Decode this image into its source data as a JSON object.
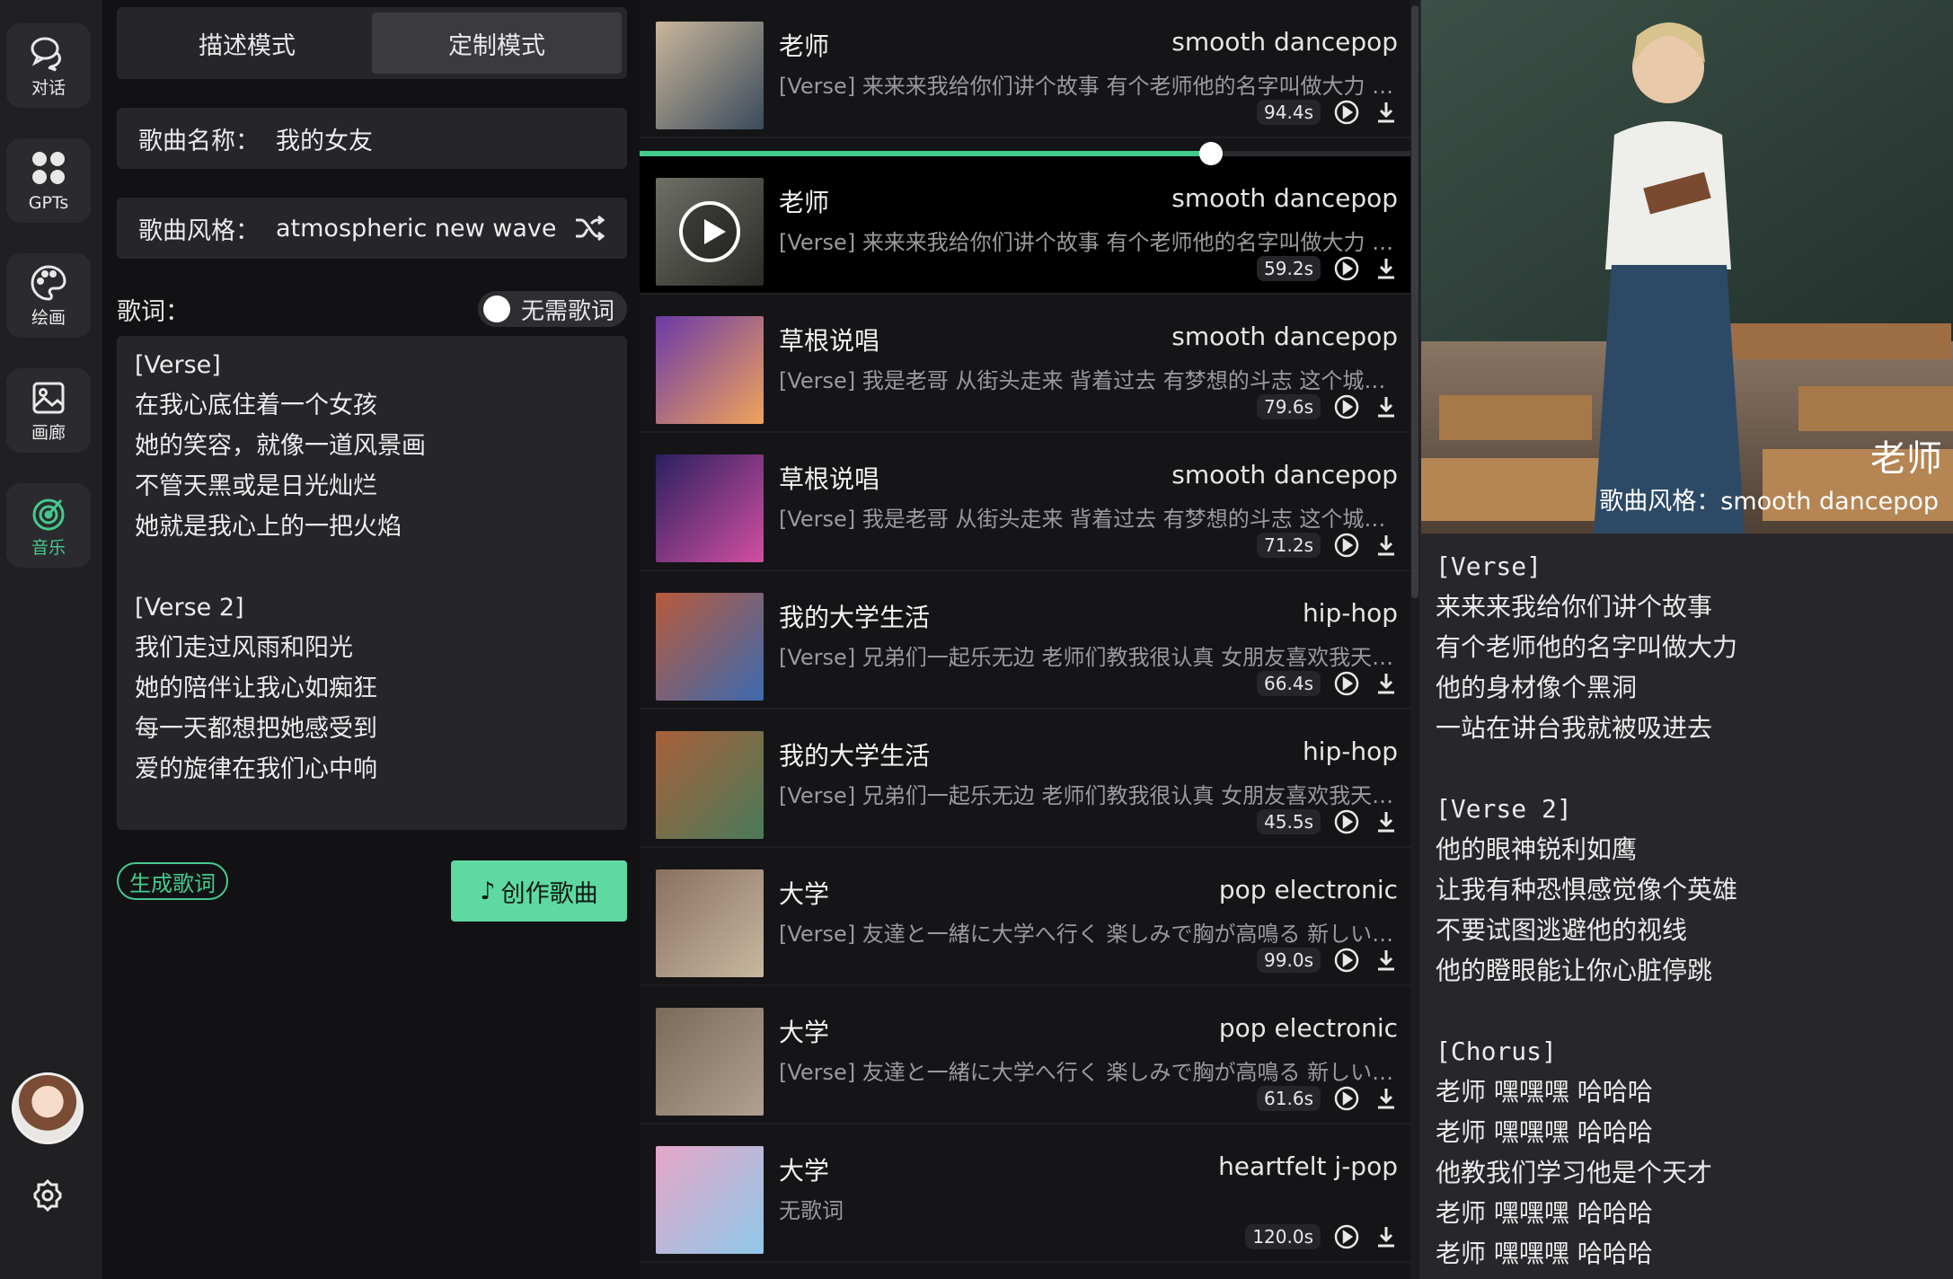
{
  "nav": {
    "items": [
      {
        "label": "对话",
        "icon": "chat-icon"
      },
      {
        "label": "GPTs",
        "icon": "grid-icon"
      },
      {
        "label": "绘画",
        "icon": "palette-icon"
      },
      {
        "label": "画廊",
        "icon": "gallery-icon"
      },
      {
        "label": "音乐",
        "icon": "music-icon",
        "active": true
      }
    ]
  },
  "form": {
    "tabs": [
      "描述模式",
      "定制模式"
    ],
    "active_tab": "定制模式",
    "song_name_label": "歌曲名称：",
    "song_name_value": "我的女友",
    "song_style_label": "歌曲风格：",
    "song_style_value": "atmospheric new wave",
    "lyrics_label": "歌词：",
    "no_lyrics_toggle": "无需歌词",
    "lyrics_lines": [
      "[Verse]",
      "在我心底住着一个女孩",
      "她的笑容，就像一道风景画",
      "不管天黑或是日光灿烂",
      "她就是我心上的一把火焰",
      "",
      "[Verse 2]",
      "我们走过风雨和阳光",
      "她的陪伴让我心如痴狂",
      "每一天都想把她感受到",
      "爱的旋律在我们心中响"
    ],
    "generate_lyrics_button": "生成歌词",
    "create_song_button": "创作歌曲"
  },
  "songs": [
    {
      "title": "老师",
      "style": "smooth dancepop",
      "lyric": "[Verse] 来来来我给你们讲个故事 有个老师他的名字叫做大力 他的身材像个黑洞",
      "duration": "94.4s"
    },
    {
      "title": "老师",
      "style": "smooth dancepop",
      "lyric": "[Verse] 来来来我给你们讲个故事 有个老师他的名字叫做大力 他的身材像个黑洞",
      "duration": "59.2s",
      "playing": true
    },
    {
      "title": "草根说唱",
      "style": "smooth dancepop",
      "lyric": "[Verse] 我是老哥 从街头走来 背着过去 有梦想的斗志 这个城市的霓虹",
      "duration": "79.6s"
    },
    {
      "title": "草根说唱",
      "style": "smooth dancepop",
      "lyric": "[Verse] 我是老哥 从街头走来 背着过去 有梦想的斗志 这个城市的霓虹",
      "duration": "71.2s"
    },
    {
      "title": "我的大学生活",
      "style": "hip-hop",
      "lyric": "[Verse] 兄弟们一起乐无边 老师们教我很认真 女朋友喜欢我天天陪伴",
      "duration": "66.4s"
    },
    {
      "title": "我的大学生活",
      "style": "hip-hop",
      "lyric": "[Verse] 兄弟们一起乐无边 老师们教我很认真 女朋友喜欢我天天陪伴",
      "duration": "45.5s"
    },
    {
      "title": "大学",
      "style": "pop electronic",
      "lyric": "[Verse] 友達と一緒に大学へ行く 楽しみで胸が高鳴る 新しい日々が始まる",
      "duration": "99.0s"
    },
    {
      "title": "大学",
      "style": "pop electronic",
      "lyric": "[Verse] 友達と一緒に大学へ行く 楽しみで胸が高鳴る 新しい日々が始まる",
      "duration": "61.6s"
    },
    {
      "title": "大学",
      "style": "heartfelt j-pop",
      "lyric": "无歌词",
      "duration": "120.0s"
    }
  ],
  "player": {
    "progress": 0.74
  },
  "detail": {
    "title": "老师",
    "style_label": "歌曲风格：",
    "style_value": "smooth dancepop",
    "lyrics_lines": [
      "[Verse]",
      "来来来我给你们讲个故事",
      "有个老师他的名字叫做大力",
      "他的身材像个黑洞",
      "一站在讲台我就被吸进去",
      "",
      "[Verse 2]",
      "他的眼神锐利如鹰",
      "让我有种恐惧感觉像个英雄",
      "不要试图逃避他的视线",
      "他的瞪眼能让你心脏停跳",
      "",
      "[Chorus]",
      "老师  嘿嘿嘿  哈哈哈",
      "老师  嘿嘿嘿  哈哈哈",
      "他教我们学习他是个天才",
      "老师  嘿嘿嘿  哈哈哈",
      "老师  嘿嘿嘿  哈哈哈"
    ]
  },
  "colors": {
    "accent": "#45c98e",
    "button": "#5ed9a2",
    "panel": "#26262a"
  }
}
